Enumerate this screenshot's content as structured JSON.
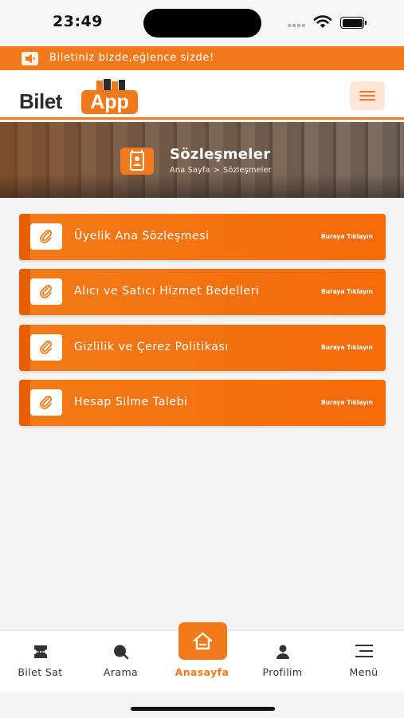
{
  "status_bar": {
    "time": "23:49"
  },
  "announcement": {
    "text": "Biletiniz bizde,eğlence sizde!",
    "icon": "megaphone-icon"
  },
  "header": {
    "logo_left": "Bilet",
    "logo_right": "App",
    "menu_icon": "hamburger-icon"
  },
  "hero": {
    "title": "Sözleşmeler",
    "breadcrumb": {
      "home": "Ana Sayfa",
      "separator": ">",
      "current": "Sözleşmeler"
    },
    "icon": "contract-icon"
  },
  "agreements": [
    {
      "label": "Üyelik Ana Sözleşmesi",
      "link": "Buraya Tıklayın"
    },
    {
      "label": "Alıcı ve Satıcı Hizmet Bedelleri",
      "link": "Buraya Tıklayın"
    },
    {
      "label": "Gizlilik ve Çerez Politikası",
      "link": "Buraya Tıklayın"
    },
    {
      "label": "Hesap Silme Talebi",
      "link": "Buraya Tıklayın"
    }
  ],
  "bottom_nav": [
    {
      "label": "Bilet Sat",
      "icon": "ticket-icon"
    },
    {
      "label": "Arama",
      "icon": "search-icon"
    },
    {
      "label": "Anasayfa",
      "icon": "home-icon",
      "active": true
    },
    {
      "label": "Profilim",
      "icon": "user-icon"
    },
    {
      "label": "Menü",
      "icon": "menu-icon"
    }
  ],
  "colors": {
    "accent": "#f27a1a",
    "accent_dark": "#e65f00"
  }
}
